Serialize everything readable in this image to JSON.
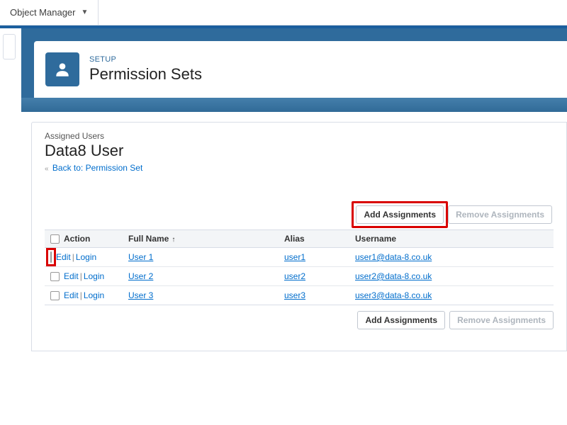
{
  "topbar": {
    "object_manager": "Object Manager"
  },
  "header": {
    "eyebrow": "SETUP",
    "title": "Permission Sets"
  },
  "panel": {
    "label": "Assigned Users",
    "title": "Data8 User",
    "back_link": "Back to: Permission Set"
  },
  "buttons": {
    "add": "Add Assignments",
    "remove": "Remove Assignments"
  },
  "table": {
    "headers": {
      "action": "Action",
      "fullname": "Full Name",
      "alias": "Alias",
      "username": "Username"
    },
    "action_labels": {
      "edit": "Edit",
      "login": "Login"
    },
    "rows": [
      {
        "fullname": "User 1",
        "alias": "user1",
        "username": "user1@data-8.co.uk"
      },
      {
        "fullname": "User 2",
        "alias": "user2",
        "username": "user2@data-8.co.uk"
      },
      {
        "fullname": "User 3",
        "alias": "user3",
        "username": "user3@data-8.co.uk"
      }
    ]
  }
}
